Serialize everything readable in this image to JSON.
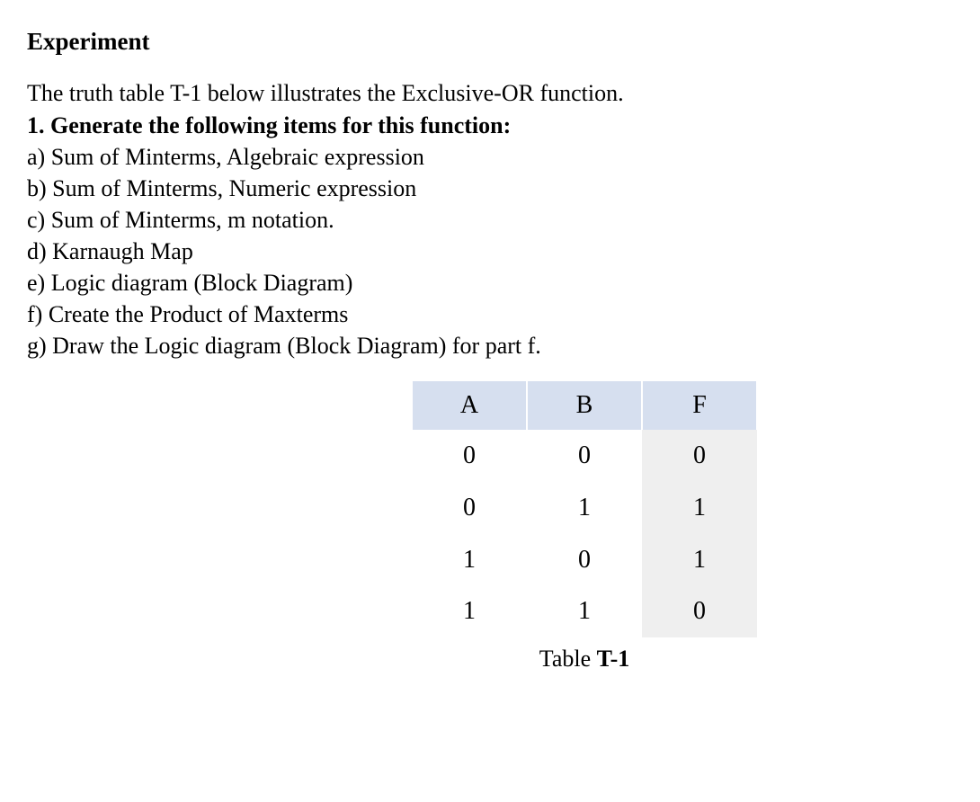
{
  "heading": "Experiment",
  "intro": "The truth table T-1 below illustrates the Exclusive-OR function.",
  "task": "1. Generate the following items for this function:",
  "items": {
    "a": "a) Sum of Minterms, Algebraic expression",
    "b": "b) Sum of Minterms, Numeric expression",
    "c": "c) Sum of Minterms, m notation.",
    "d": "d) Karnaugh Map",
    "e": "e) Logic diagram (Block Diagram)",
    "f": "f) Create the Product of Maxterms",
    "g": "g) Draw the Logic diagram (Block Diagram) for part f."
  },
  "table": {
    "headers": {
      "a": "A",
      "b": "B",
      "f": "F"
    },
    "rows": [
      {
        "a": "0",
        "b": "0",
        "f": "0"
      },
      {
        "a": "0",
        "b": "1",
        "f": "1"
      },
      {
        "a": "1",
        "b": "0",
        "f": "1"
      },
      {
        "a": "1",
        "b": "1",
        "f": "0"
      }
    ],
    "caption_prefix": "Table ",
    "caption_label": "T-1"
  },
  "chart_data": {
    "type": "table",
    "title": "Table T-1",
    "columns": [
      "A",
      "B",
      "F"
    ],
    "rows": [
      [
        0,
        0,
        0
      ],
      [
        0,
        1,
        1
      ],
      [
        1,
        0,
        1
      ],
      [
        1,
        1,
        0
      ]
    ]
  }
}
